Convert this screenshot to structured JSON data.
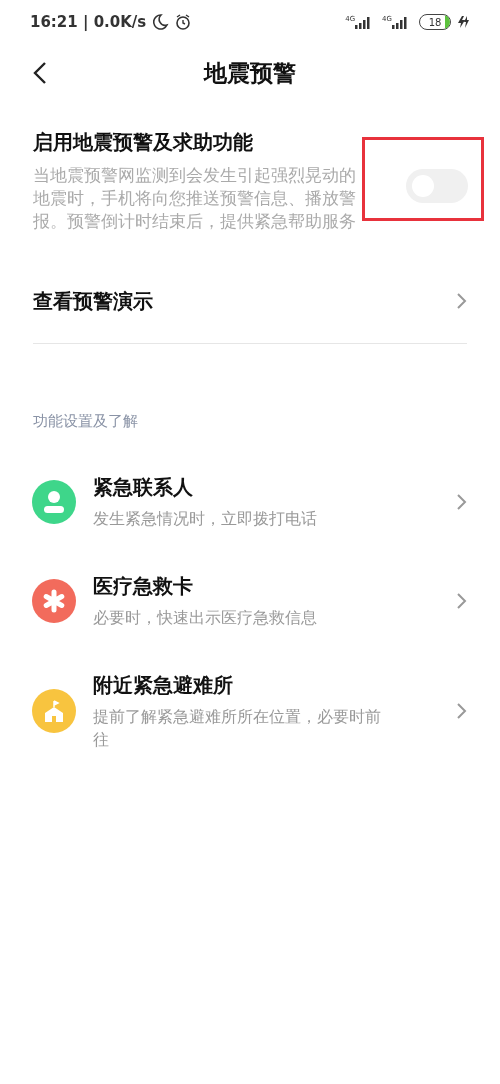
{
  "status_bar": {
    "time": "16:21 | 0.0K/s",
    "signals": [
      {
        "label": "4G"
      },
      {
        "label": "4G"
      }
    ],
    "battery": "18"
  },
  "header": {
    "title": "地震预警"
  },
  "main_setting": {
    "title": "启用地震预警及求助功能",
    "description": "当地震预警网监测到会发生引起强烈晃动的地震时，手机将向您推送预警信息、播放警报。预警倒计时结束后，提供紧急帮助服务",
    "on": false,
    "highlighted": true
  },
  "demo_link": {
    "label": "查看预警演示"
  },
  "section": {
    "title": "功能设置及了解"
  },
  "items": [
    {
      "kind": "contact",
      "color": "#3ed68a",
      "title": "紧急联系人",
      "subtitle": "发生紧急情况时，立即拨打电话"
    },
    {
      "kind": "medical",
      "color": "#f26b5c",
      "title": "医疗急救卡",
      "subtitle": "必要时，快速出示医疗急救信息"
    },
    {
      "kind": "shelter",
      "color": "#f8c43f",
      "title": "附近紧急避难所",
      "subtitle": "提前了解紧急避难所所在位置，必要时前往"
    }
  ]
}
